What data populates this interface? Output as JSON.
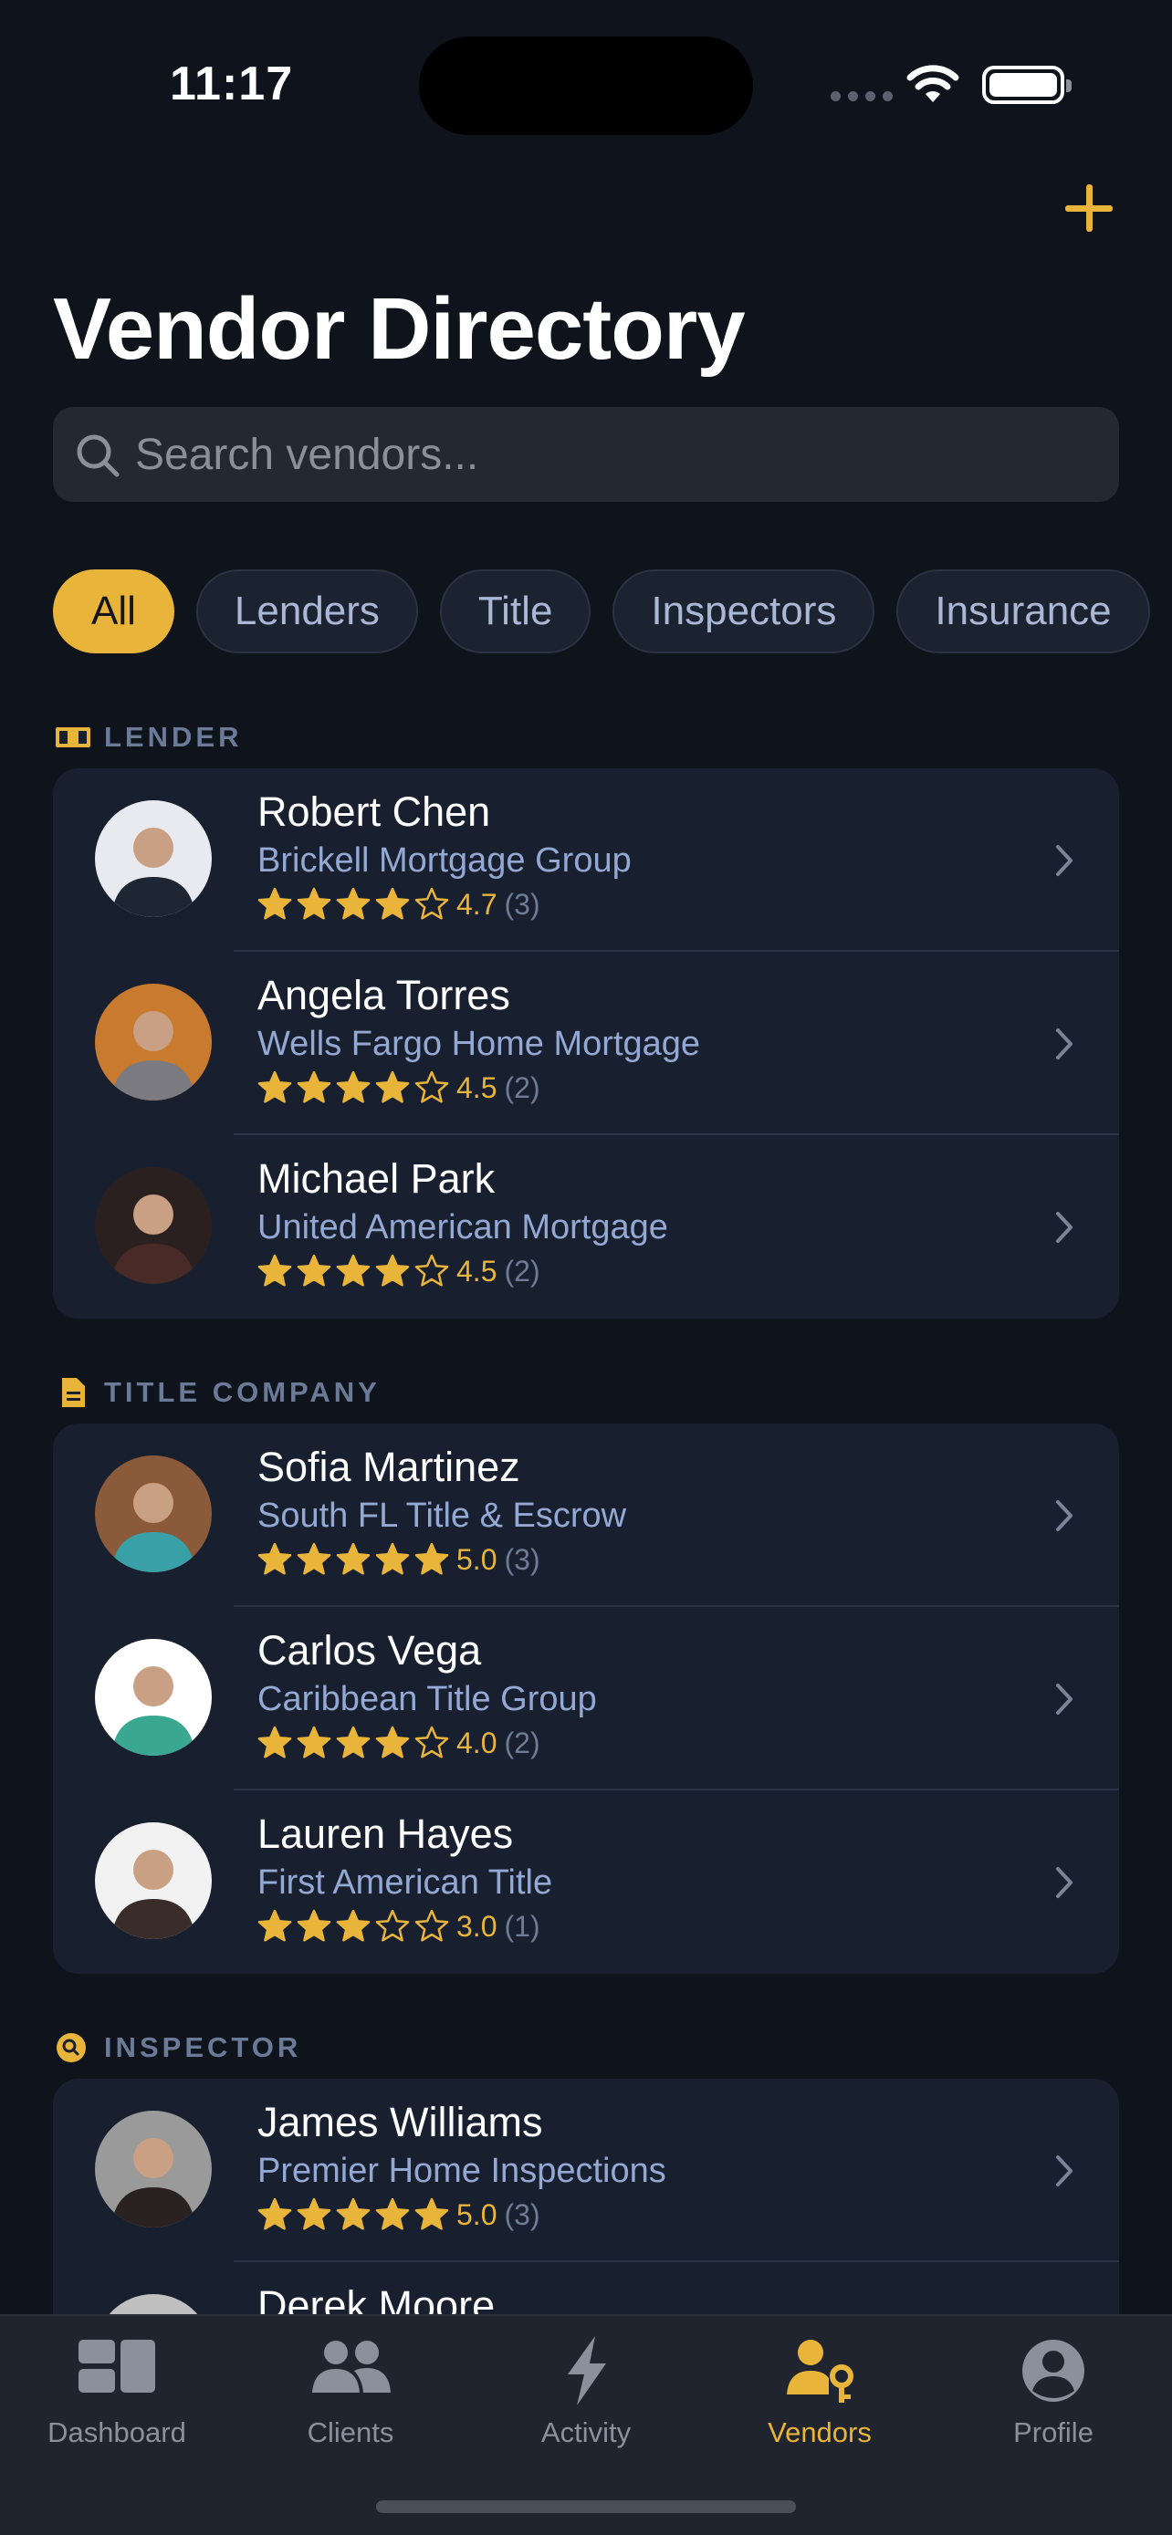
{
  "status_bar": {
    "time": "11:17"
  },
  "header": {
    "title": "Vendor Directory"
  },
  "search": {
    "placeholder": "Search vendors..."
  },
  "filters": [
    "All",
    "Lenders",
    "Title",
    "Inspectors",
    "Insurance"
  ],
  "sections": [
    {
      "title": "LENDER",
      "icon": "money-icon",
      "vendors": [
        {
          "name": "Robert Chen",
          "company": "Brickell Mortgage Group",
          "rating": "4.7",
          "stars": 4,
          "count": "(3)",
          "avatar_colors": [
            "#e8eaef",
            "#1e2633"
          ]
        },
        {
          "name": "Angela Torres",
          "company": "Wells Fargo Home Mortgage",
          "rating": "4.5",
          "stars": 4,
          "count": "(2)",
          "avatar_colors": [
            "#c87a2e",
            "#7a7a80"
          ]
        },
        {
          "name": "Michael Park",
          "company": "United American Mortgage",
          "rating": "4.5",
          "stars": 4,
          "count": "(2)",
          "avatar_colors": [
            "#2b2020",
            "#4a2a26"
          ]
        }
      ]
    },
    {
      "title": "TITLE COMPANY",
      "icon": "document-icon",
      "vendors": [
        {
          "name": "Sofia Martinez",
          "company": "South FL Title & Escrow",
          "rating": "5.0",
          "stars": 5,
          "count": "(3)",
          "avatar_colors": [
            "#8a5a3a",
            "#3aa0a8"
          ]
        },
        {
          "name": "Carlos Vega",
          "company": "Caribbean Title Group",
          "rating": "4.0",
          "stars": 4,
          "count": "(2)",
          "avatar_colors": [
            "#ffffff",
            "#3aa890"
          ]
        },
        {
          "name": "Lauren Hayes",
          "company": "First American Title",
          "rating": "3.0",
          "stars": 3,
          "count": "(1)",
          "avatar_colors": [
            "#f2f2f2",
            "#3a2c28"
          ]
        }
      ]
    },
    {
      "title": "INSPECTOR",
      "icon": "magnifier-badge-icon",
      "vendors": [
        {
          "name": "James Williams",
          "company": "Premier Home Inspections",
          "rating": "5.0",
          "stars": 5,
          "count": "(3)",
          "avatar_colors": [
            "#9a9a9a",
            "#2a2220"
          ]
        },
        {
          "name": "Derek Moore",
          "company": "",
          "rating": "",
          "stars": 0,
          "count": "",
          "avatar_colors": [
            "#c0c0c0",
            "#555555"
          ]
        }
      ]
    }
  ],
  "tabs": [
    {
      "label": "Dashboard",
      "icon": "dashboard-icon",
      "active": false
    },
    {
      "label": "Clients",
      "icon": "clients-icon",
      "active": false
    },
    {
      "label": "Activity",
      "icon": "bolt-icon",
      "active": false
    },
    {
      "label": "Vendors",
      "icon": "vendor-key-icon",
      "active": true
    },
    {
      "label": "Profile",
      "icon": "profile-icon",
      "active": false
    }
  ],
  "colors": {
    "accent": "#e9b43a",
    "background": "#0e131c",
    "card": "#182030"
  }
}
